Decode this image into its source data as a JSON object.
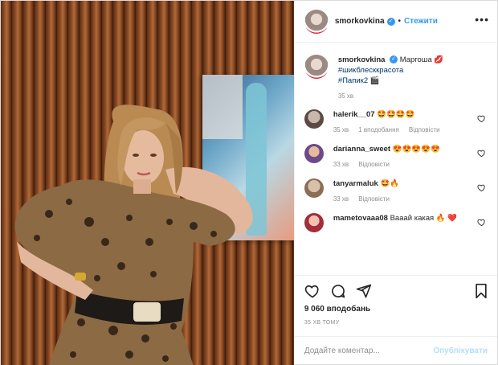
{
  "header": {
    "username": "smorkovkina",
    "verified_symbol": "✓",
    "separator": "•",
    "follow_label": "Стежити",
    "more_label": "•••"
  },
  "caption": {
    "username": "smorkovkina",
    "text": "Маргоша 💋",
    "tags": [
      "#шикблесккрасота",
      "#Папик2 🎬"
    ],
    "time": "35 хв"
  },
  "comments": [
    {
      "username": "halerik__07",
      "text": "🤩🤩🤩🤩",
      "time": "35 хв",
      "likes": "1 вподобання",
      "reply": "Відповісти"
    },
    {
      "username": "darianna_sweet",
      "text": "😍😍😍😍😍",
      "time": "33 хв",
      "reply": "Відповісти"
    },
    {
      "username": "tanyarmaluk",
      "text": "🤩🔥",
      "time": "33 хв",
      "reply": "Відповісти"
    },
    {
      "username": "mametovaaa08",
      "text": "Вааай какая 🔥 ❤️"
    }
  ],
  "likes_text": "9 060 вподобань",
  "time_ago": "35 ХВ ТОМУ",
  "comment_box": {
    "placeholder": "Додайте коментар...",
    "publish_label": "Опублікувати"
  },
  "icons": [
    "heart-icon",
    "comment-icon",
    "share-icon",
    "bookmark-icon",
    "more-icon",
    "verified-icon"
  ],
  "colors": {
    "link": "#3897f0",
    "publish_disabled": "#b2dffc",
    "muted": "#8e8e8e",
    "text": "#262626"
  }
}
